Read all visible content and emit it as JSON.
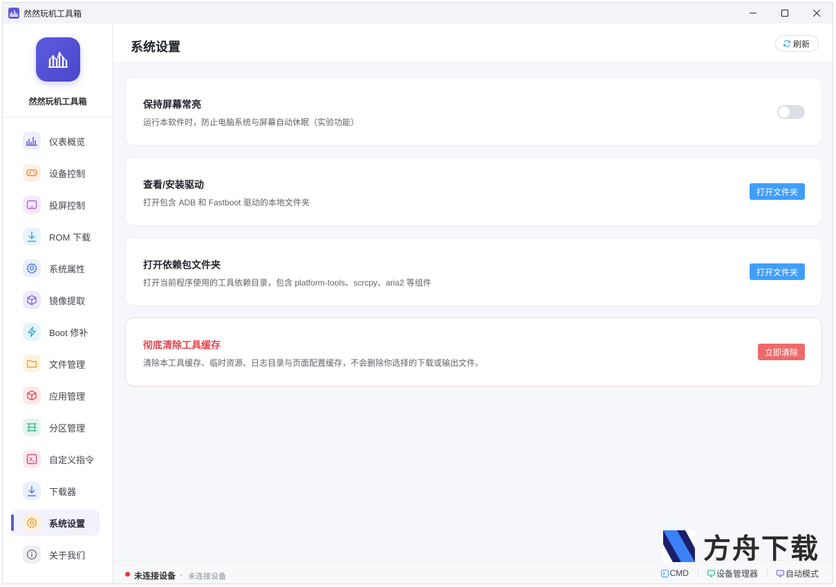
{
  "window": {
    "title": "然然玩机工具箱"
  },
  "sidebar": {
    "brand_name": "然然玩机工具箱",
    "items": [
      {
        "label": "仪表概览",
        "icon": "chart-icon",
        "color": "#5b5bd6",
        "bg": "#eceefc"
      },
      {
        "label": "设备控制",
        "icon": "gamepad-icon",
        "color": "#f08a3c",
        "bg": "#fdf0e6"
      },
      {
        "label": "投屏控制",
        "icon": "screen-icon",
        "color": "#b05fd8",
        "bg": "#f5eafb"
      },
      {
        "label": "ROM 下载",
        "icon": "download-icon",
        "color": "#3aa8d8",
        "bg": "#e6f5fb"
      },
      {
        "label": "系统属性",
        "icon": "settings-icon",
        "color": "#4f7fe0",
        "bg": "#e9effc"
      },
      {
        "label": "镜像提取",
        "icon": "cube-icon",
        "color": "#7c5cd6",
        "bg": "#efeafb"
      },
      {
        "label": "Boot 修补",
        "icon": "bolt-icon",
        "color": "#2fa4c6",
        "bg": "#e5f5fa"
      },
      {
        "label": "文件管理",
        "icon": "folder-icon",
        "color": "#e8a33a",
        "bg": "#fdf3e1"
      },
      {
        "label": "应用管理",
        "icon": "box-icon",
        "color": "#e0474f",
        "bg": "#fce9ea"
      },
      {
        "label": "分区管理",
        "icon": "list-icon",
        "color": "#2fb48a",
        "bg": "#e3f6ee"
      },
      {
        "label": "自定义指令",
        "icon": "terminal-icon",
        "color": "#d9467a",
        "bg": "#fbe7ef"
      },
      {
        "label": "下载器",
        "icon": "download-icon",
        "color": "#4f7fe0",
        "bg": "#e9effc"
      },
      {
        "label": "系统设置",
        "icon": "settings-icon",
        "color": "#f0a030",
        "bg": "#fdf1dd",
        "active": true
      },
      {
        "label": "关于我们",
        "icon": "info-icon",
        "color": "#6b6f76",
        "bg": "#eeeff1"
      }
    ]
  },
  "header": {
    "title": "系统设置",
    "refresh_label": "刷新"
  },
  "cards": [
    {
      "title": "保持屏幕常亮",
      "desc": "运行本软件时，防止电脑系统与屏幕自动休眠（实验功能）",
      "toggle_on": false
    },
    {
      "title": "查看/安装驱动",
      "desc": "打开包含 ADB 和 Fastboot 驱动的本地文件夹",
      "button": "打开文件夹"
    },
    {
      "title": "打开依赖包文件夹",
      "desc": "打开当前程序使用的工具依赖目录，包含 platform-tools、scrcpy、aria2 等组件",
      "button": "打开文件夹"
    },
    {
      "title": "彻底清除工具缓存",
      "desc": "清除本工具缓存、临时资源、日志目录与页面配置缓存，不会删除你选择的下载或输出文件。",
      "button": "立即清除",
      "danger": true
    }
  ],
  "status": {
    "main": "未连接设备",
    "sep": "-",
    "sub": "未连接设备",
    "links": [
      "CMD",
      "设备管理器",
      "自动模式"
    ]
  },
  "watermark": {
    "text": "方舟下载"
  },
  "colors": {
    "accent": "#5b5bd6",
    "primary_button": "#409eff",
    "danger_button": "#ef6a6a",
    "danger_text": "#e0474f"
  }
}
